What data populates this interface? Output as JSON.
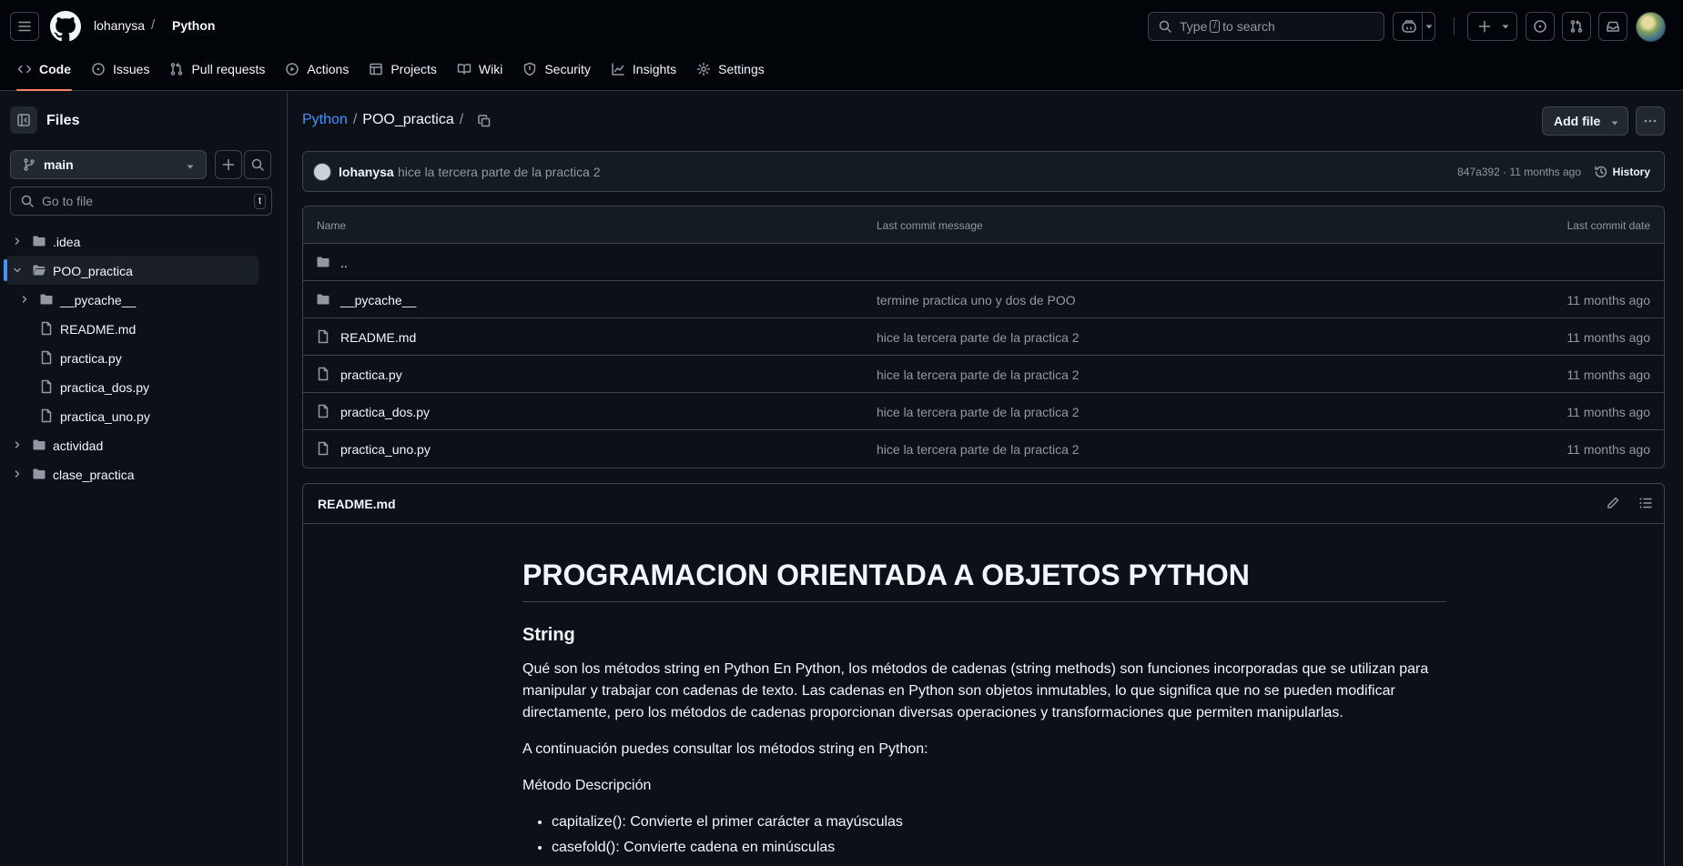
{
  "header": {
    "owner": "lohanysa",
    "separator": "/",
    "repo": "Python",
    "search": {
      "before": "Type",
      "key": "/",
      "after": "to search"
    }
  },
  "repo_nav": [
    {
      "label": "Code",
      "icon": "code-icon",
      "active": true
    },
    {
      "label": "Issues",
      "icon": "issue-icon"
    },
    {
      "label": "Pull requests",
      "icon": "pull-request-icon"
    },
    {
      "label": "Actions",
      "icon": "play-icon"
    },
    {
      "label": "Projects",
      "icon": "table-icon"
    },
    {
      "label": "Wiki",
      "icon": "book-icon"
    },
    {
      "label": "Security",
      "icon": "shield-icon"
    },
    {
      "label": "Insights",
      "icon": "graph-icon"
    },
    {
      "label": "Settings",
      "icon": "gear-icon"
    }
  ],
  "sidebar": {
    "title": "Files",
    "branch": "main",
    "goto_placeholder": "Go to file",
    "goto_key": "t",
    "tree": [
      {
        "label": ".idea",
        "type": "folder",
        "depth": 0,
        "expanded": false
      },
      {
        "label": "POO_practica",
        "type": "folder",
        "depth": 0,
        "expanded": true,
        "selected": true
      },
      {
        "label": "__pycache__",
        "type": "folder",
        "depth": 1,
        "expanded": false
      },
      {
        "label": "README.md",
        "type": "file",
        "depth": 1
      },
      {
        "label": "practica.py",
        "type": "file",
        "depth": 1
      },
      {
        "label": "practica_dos.py",
        "type": "file",
        "depth": 1
      },
      {
        "label": "practica_uno.py",
        "type": "file",
        "depth": 1
      },
      {
        "label": "actividad",
        "type": "folder",
        "depth": 0,
        "expanded": false
      },
      {
        "label": "clase_practica",
        "type": "folder",
        "depth": 0,
        "expanded": false
      }
    ]
  },
  "main": {
    "path": {
      "repo": "Python",
      "sep": "/",
      "folder": "POO_practica",
      "trail": "/"
    },
    "add_file": "Add file",
    "commit": {
      "author": "lohanysa",
      "message": "hice la tercera parte de la practica 2",
      "meta": "847a392 · 11 months ago",
      "history": "History"
    },
    "table": {
      "headers": {
        "name": "Name",
        "message": "Last commit message",
        "date": "Last commit date"
      },
      "parent": "..",
      "rows": [
        {
          "name": "__pycache__",
          "type": "folder",
          "message": "termine practica uno y dos de POO",
          "date": "11 months ago"
        },
        {
          "name": "README.md",
          "type": "file",
          "message": "hice la tercera parte de la practica 2",
          "date": "11 months ago"
        },
        {
          "name": "practica.py",
          "type": "file",
          "message": "hice la tercera parte de la practica 2",
          "date": "11 months ago"
        },
        {
          "name": "practica_dos.py",
          "type": "file",
          "message": "hice la tercera parte de la practica 2",
          "date": "11 months ago"
        },
        {
          "name": "practica_uno.py",
          "type": "file",
          "message": "hice la tercera parte de la practica 2",
          "date": "11 months ago"
        }
      ]
    },
    "readme": {
      "title": "README.md",
      "h1": "PROGRAMACION ORIENTADA A OBJETOS PYTHON",
      "h2": "String",
      "p1": "Qué son los métodos string en Python En Python, los métodos de cadenas (string methods) son funciones incorporadas que se utilizan para manipular y trabajar con cadenas de texto. Las cadenas en Python son objetos inmutables, lo que significa que no se pueden modificar directamente, pero los métodos de cadenas proporcionan diversas operaciones y transformaciones que permiten manipularlas.",
      "p2": "A continuación puedes consultar los métodos string en Python:",
      "p3": "Método Descripción",
      "list": [
        "capitalize(): Convierte el primer carácter a mayúsculas",
        "casefold(): Convierte cadena en minúsculas"
      ]
    }
  }
}
